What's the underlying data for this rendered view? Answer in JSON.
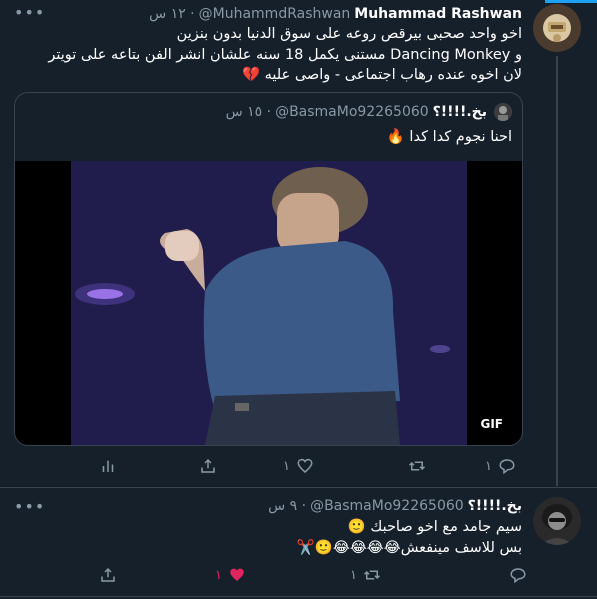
{
  "tweet1": {
    "name": "Muhammad Rashwan",
    "handle": "@MuhammdRashwan",
    "time": "· ١٢ س",
    "lines": [
      "اخو واحد صحبى بيرقص روعه على سوق الدنيا بدون بنزين",
      "و Dancing Monkey مستنى يكمل 18 سنه علشان انشر الفن بتاعه على تويتر",
      "لان اخوه عنده رهاب اجتماعى - واصى عليه 💔"
    ],
    "more_icon": "more-dots",
    "quote": {
      "name": "بخ.!!!!؟",
      "handle": "@BasmaMo92265060",
      "time": "· ١٥ س",
      "text": "احنا نجوم كدا كدا 🔥",
      "media_badge": "GIF"
    },
    "actions": {
      "reply_count": "١",
      "retweet_count": "",
      "like_count": "١"
    }
  },
  "tweet2": {
    "name": "بخ.!!!!؟",
    "handle": "@BasmaMo92265060",
    "time": "· ٩ س",
    "lines": [
      "سيم جامد مع اخو صاحبك 🙂",
      "بس للاسف مينفعش😂😂😂😂🙂✂️"
    ],
    "actions": {
      "reply_count": "",
      "retweet_count": "١",
      "like_count": "١"
    },
    "colors": {
      "like_active": "#e0245e"
    }
  }
}
